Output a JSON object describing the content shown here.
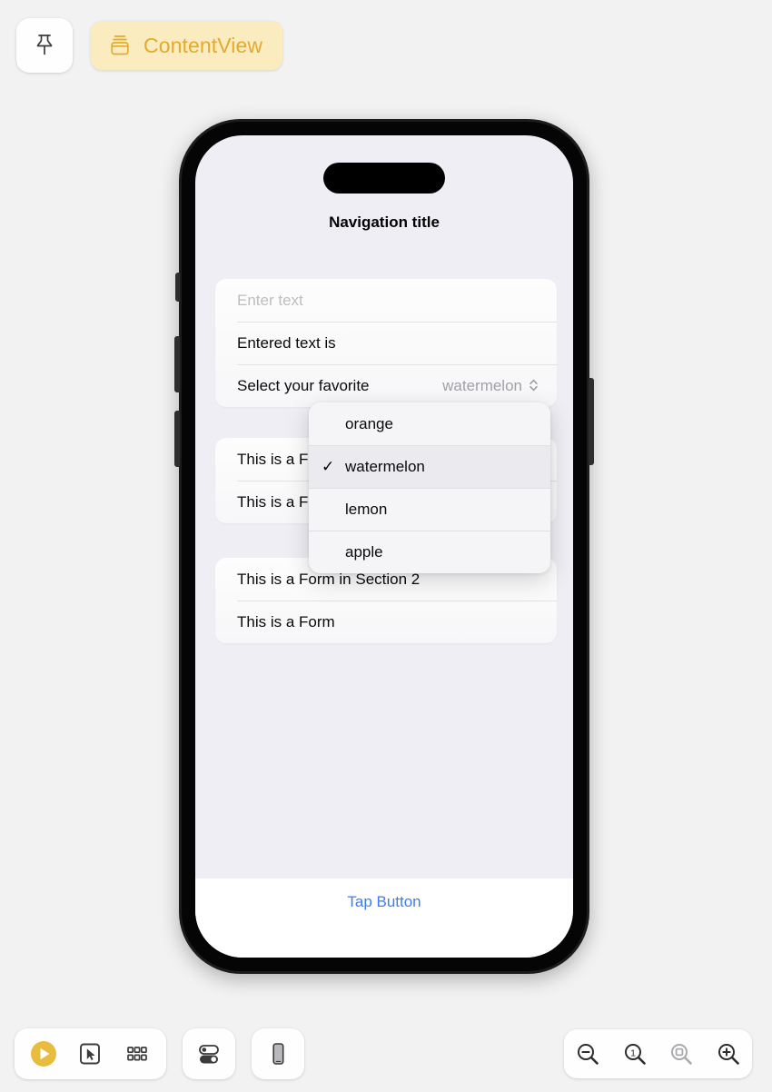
{
  "top_bar": {
    "pin_button": {
      "icon": "pin-icon"
    },
    "content_tab": {
      "label": "ContentView",
      "icon": "struct-box-icon",
      "accent": "#e2ab2d",
      "background": "#faecbe"
    }
  },
  "device": {
    "navigation_title": "Navigation title",
    "screen_background": "#eeeef4",
    "sections": [
      {
        "id": "section-1",
        "rows": [
          {
            "type": "textfield",
            "placeholder": "Enter text",
            "value": ""
          },
          {
            "type": "label",
            "label": "Entered text is",
            "value": ""
          },
          {
            "type": "picker",
            "label": "Select your favorite",
            "value": "watermelon",
            "chevron": "chevron-up-down-icon"
          }
        ]
      },
      {
        "id": "section-2",
        "rows": [
          {
            "type": "label",
            "label": "This is a Form"
          },
          {
            "type": "label",
            "label": "This is a Form"
          }
        ]
      },
      {
        "id": "section-3",
        "rows": [
          {
            "type": "label",
            "label": "This is a Form in Section 2"
          },
          {
            "type": "label",
            "label": "This is a Form"
          }
        ]
      }
    ],
    "picker_menu": {
      "open": true,
      "selected": "watermelon",
      "check_glyph": "✓",
      "options": [
        {
          "label": "orange",
          "selected": false
        },
        {
          "label": "watermelon",
          "selected": true
        },
        {
          "label": "lemon",
          "selected": false
        },
        {
          "label": "apple",
          "selected": false
        }
      ]
    },
    "tap_button": {
      "label": "Tap Button",
      "color": "#3b7ef2"
    }
  },
  "bottom_toolbar": {
    "group_preview": [
      {
        "name": "play-button",
        "icon": "play-circle-icon",
        "color": "#e8bc3e"
      },
      {
        "name": "inspect-button",
        "icon": "cursor-rectangle-icon"
      },
      {
        "name": "grid-button",
        "icon": "grid-9-icon"
      }
    ],
    "group_settings": [
      {
        "name": "toggles-button",
        "icon": "switches-icon"
      }
    ],
    "group_device": [
      {
        "name": "device-button",
        "icon": "iphone-icon"
      }
    ],
    "zoom_controls": [
      {
        "name": "zoom-out-button",
        "icon": "magnifier-minus-icon",
        "label": "−"
      },
      {
        "name": "zoom-actual-button",
        "icon": "magnifier-one-icon",
        "label": "1"
      },
      {
        "name": "zoom-fit-button",
        "icon": "magnifier-fit-icon",
        "label": "",
        "disabled": true
      },
      {
        "name": "zoom-in-button",
        "icon": "magnifier-plus-icon",
        "label": "+"
      }
    ]
  }
}
